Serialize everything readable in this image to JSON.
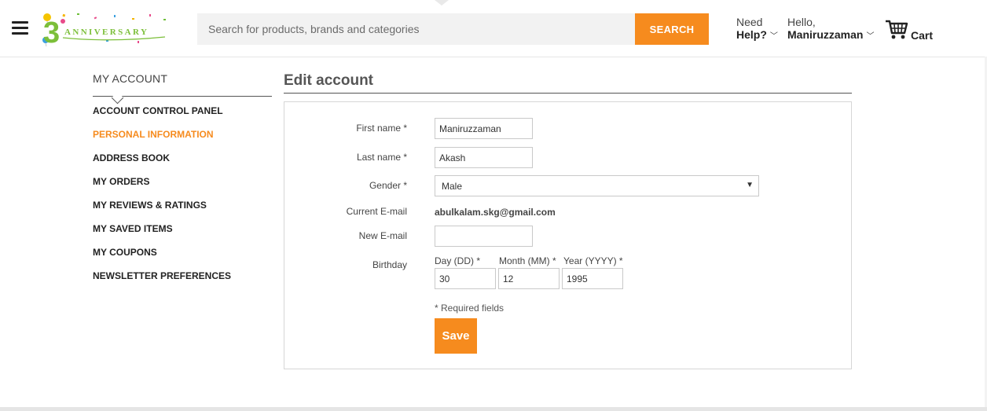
{
  "header": {
    "search_placeholder": "Search for products, brands and categories",
    "search_button": "SEARCH",
    "help_line1": "Need",
    "help_line2": "Help?",
    "user_line1": "Hello,",
    "user_name": "Maniruzzaman",
    "cart_label": "Cart"
  },
  "logo": {
    "number": "3",
    "word": "ANNIVERSARY"
  },
  "sidebar": {
    "title": "MY ACCOUNT",
    "items": [
      {
        "label": "ACCOUNT CONTROL PANEL",
        "active": false
      },
      {
        "label": "PERSONAL INFORMATION",
        "active": true
      },
      {
        "label": "ADDRESS BOOK",
        "active": false
      },
      {
        "label": "MY ORDERS",
        "active": false
      },
      {
        "label": "MY REVIEWS & RATINGS",
        "active": false
      },
      {
        "label": "MY SAVED ITEMS",
        "active": false
      },
      {
        "label": "MY COUPONS",
        "active": false
      },
      {
        "label": "NEWSLETTER PREFERENCES",
        "active": false
      }
    ]
  },
  "form": {
    "title": "Edit account",
    "first_name_label": "First name *",
    "first_name_value": "Maniruzzaman",
    "last_name_label": "Last name *",
    "last_name_value": "Akash",
    "gender_label": "Gender *",
    "gender_value": "Male",
    "current_email_label": "Current E-mail",
    "current_email_value": "abulkalam.skg@gmail.com",
    "new_email_label": "New E-mail",
    "new_email_value": "",
    "birthday_label": "Birthday",
    "day_label": "Day (DD) *",
    "day_value": "30",
    "month_label": "Month (MM) *",
    "month_value": "12",
    "year_label": "Year (YYYY) *",
    "year_value": "1995",
    "required_note": "* Required fields",
    "save_label": "Save"
  },
  "colors": {
    "accent": "#f68b1e"
  },
  "icons": {
    "menu": "hamburger-icon",
    "cart": "cart-icon",
    "chevron": "chevron-down-icon",
    "select_arrow": "triangle-down-icon"
  }
}
